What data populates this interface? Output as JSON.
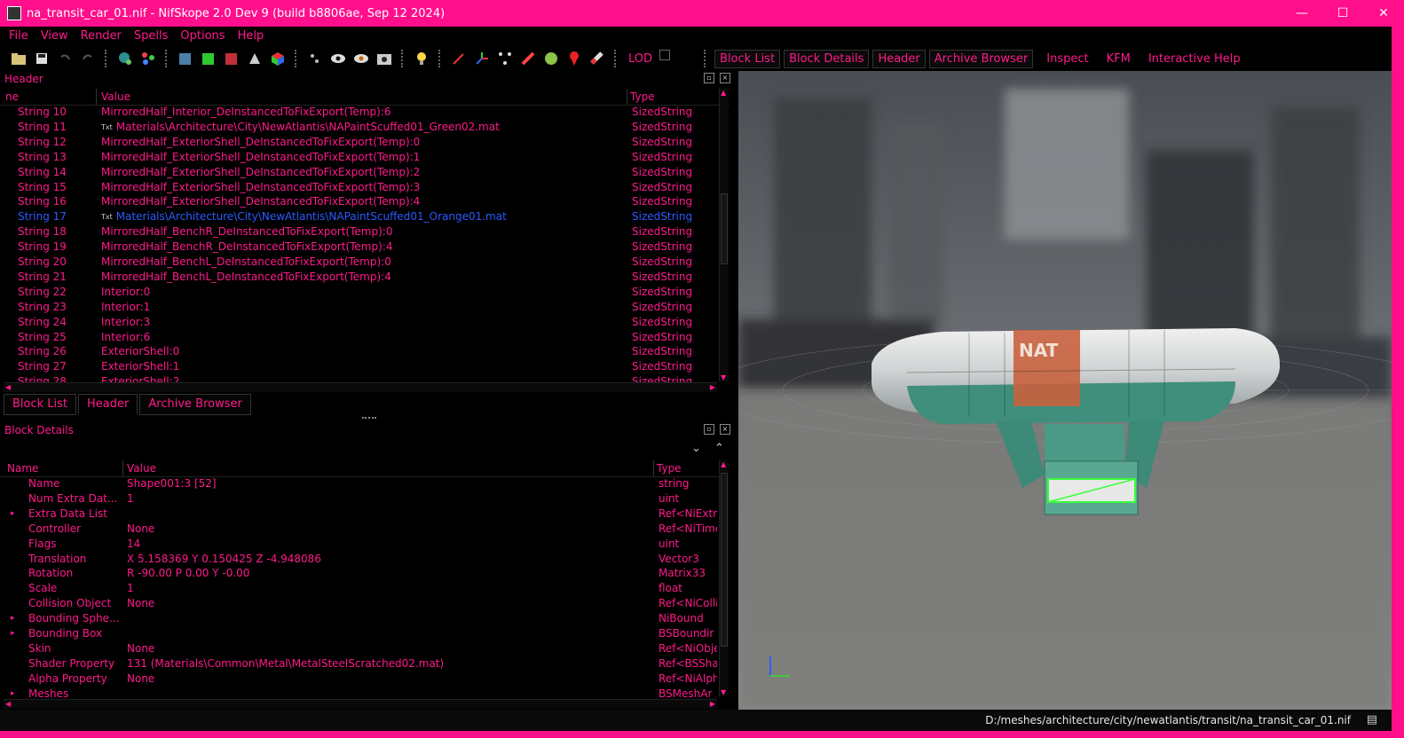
{
  "window": {
    "title": "na_transit_car_01.nif - NifSkope 2.0 Dev 9 (build b8806ae, Sep 12 2024)",
    "minimize": "—",
    "maximize": "☐",
    "close": "✕"
  },
  "menu": [
    "File",
    "View",
    "Render",
    "Spells",
    "Options",
    "Help"
  ],
  "toolbar": {
    "lod_label": "LOD",
    "dock_buttons": [
      "Block List",
      "Block Details",
      "Header",
      "Archive Browser"
    ],
    "links": [
      "Inspect",
      "KFM",
      "Interactive Help"
    ],
    "icons": [
      "open-folder-icon",
      "save-icon",
      "undo-icon",
      "redo-icon",
      "globe-icon",
      "nodes-icon",
      "cube-blue-icon",
      "cube-green-icon",
      "cube-red-icon",
      "sword-icon",
      "cube-rgb-icon",
      "footprint-icon",
      "eye-icon",
      "eye-alt-icon",
      "screenshot-icon",
      "bulb-icon",
      "axis-arrow-icon",
      "axes-icon",
      "graph-icon",
      "pencil-icon",
      "sphere-icon",
      "pin-icon",
      "paint-icon"
    ]
  },
  "header_panel": {
    "title": "Header",
    "columns": [
      "ne",
      "Value",
      "Type"
    ],
    "rows": [
      {
        "name": "String 10",
        "value": "MirroredHalf_Interior_DeInstancedToFixExport(Temp):6",
        "type": "SizedString",
        "txt": false
      },
      {
        "name": "String 11",
        "value": "Materials\\Architecture\\City\\NewAtlantis\\NAPaintScuffed01_Green02.mat",
        "type": "SizedString",
        "txt": true
      },
      {
        "name": "String 12",
        "value": "MirroredHalf_ExteriorShell_DeInstancedToFixExport(Temp):0",
        "type": "SizedString",
        "txt": false
      },
      {
        "name": "String 13",
        "value": "MirroredHalf_ExteriorShell_DeInstancedToFixExport(Temp):1",
        "type": "SizedString",
        "txt": false
      },
      {
        "name": "String 14",
        "value": "MirroredHalf_ExteriorShell_DeInstancedToFixExport(Temp):2",
        "type": "SizedString",
        "txt": false
      },
      {
        "name": "String 15",
        "value": "MirroredHalf_ExteriorShell_DeInstancedToFixExport(Temp):3",
        "type": "SizedString",
        "txt": false
      },
      {
        "name": "String 16",
        "value": "MirroredHalf_ExteriorShell_DeInstancedToFixExport(Temp):4",
        "type": "SizedString",
        "txt": false
      },
      {
        "name": "String 17",
        "value": "Materials\\Architecture\\City\\NewAtlantis\\NAPaintScuffed01_Orange01.mat",
        "type": "SizedString",
        "txt": true,
        "selected": true
      },
      {
        "name": "String 18",
        "value": "MirroredHalf_BenchR_DeInstancedToFixExport(Temp):0",
        "type": "SizedString",
        "txt": false
      },
      {
        "name": "String 19",
        "value": "MirroredHalf_BenchR_DeInstancedToFixExport(Temp):4",
        "type": "SizedString",
        "txt": false
      },
      {
        "name": "String 20",
        "value": "MirroredHalf_BenchL_DeInstancedToFixExport(Temp):0",
        "type": "SizedString",
        "txt": false
      },
      {
        "name": "String 21",
        "value": "MirroredHalf_BenchL_DeInstancedToFixExport(Temp):4",
        "type": "SizedString",
        "txt": false
      },
      {
        "name": "String 22",
        "value": "Interior:0",
        "type": "SizedString",
        "txt": false
      },
      {
        "name": "String 23",
        "value": "Interior:1",
        "type": "SizedString",
        "txt": false
      },
      {
        "name": "String 24",
        "value": "Interior:3",
        "type": "SizedString",
        "txt": false
      },
      {
        "name": "String 25",
        "value": "Interior:6",
        "type": "SizedString",
        "txt": false
      },
      {
        "name": "String 26",
        "value": "ExteriorShell:0",
        "type": "SizedString",
        "txt": false
      },
      {
        "name": "String 27",
        "value": "ExteriorShell:1",
        "type": "SizedString",
        "txt": false
      },
      {
        "name": "String 28",
        "value": "ExteriorShell:2",
        "type": "SizedString",
        "txt": false
      }
    ]
  },
  "bottom_tabs": [
    "Block List",
    "Header",
    "Archive Browser"
  ],
  "details_panel": {
    "title": "Block Details",
    "columns": [
      "Name",
      "Value",
      "Type"
    ],
    "rows": [
      {
        "name": "Name",
        "value": "Shape001:3 [52]",
        "type": "string",
        "expand": false
      },
      {
        "name": "Num Extra Dat...",
        "value": "1",
        "type": "uint",
        "expand": false
      },
      {
        "name": "Extra Data List",
        "value": "",
        "type": "Ref<NiExtr",
        "expand": true
      },
      {
        "name": "Controller",
        "value": "None",
        "type": "Ref<NiTime",
        "expand": false
      },
      {
        "name": "Flags",
        "value": "14",
        "type": "uint",
        "expand": false
      },
      {
        "name": "Translation",
        "value": "X 5.158369 Y 0.150425 Z -4.948086",
        "type": "Vector3",
        "expand": false
      },
      {
        "name": "Rotation",
        "value": "R -90.00 P 0.00 Y -0.00",
        "type": "Matrix33",
        "expand": false
      },
      {
        "name": "Scale",
        "value": "1",
        "type": "float",
        "expand": false
      },
      {
        "name": "Collision Object",
        "value": "None",
        "type": "Ref<NiColli",
        "expand": false
      },
      {
        "name": "Bounding Sphe...",
        "value": "",
        "type": "NiBound",
        "expand": true
      },
      {
        "name": "Bounding Box",
        "value": "",
        "type": "BSBoundir",
        "expand": true
      },
      {
        "name": "Skin",
        "value": "None",
        "type": "Ref<NiObje",
        "expand": false
      },
      {
        "name": "Shader Property",
        "value": "131 (Materials\\Common\\Metal\\MetalSteelScratched02.mat)",
        "type": "Ref<BSSha",
        "expand": false
      },
      {
        "name": "Alpha Property",
        "value": "None",
        "type": "Ref<NiAlph",
        "expand": false
      },
      {
        "name": "Meshes",
        "value": "",
        "type": "BSMeshAr",
        "expand": true
      }
    ]
  },
  "statusbar": {
    "path": "D:/meshes/architecture/city/newatlantis/transit/na_transit_car_01.nif"
  },
  "viewport": {
    "sign_text": "NAT"
  },
  "colors": {
    "accent": "#ff1a8c",
    "titlebar": "#ff0f8c",
    "selected_row": "#2b5bff",
    "background": "#000000"
  }
}
